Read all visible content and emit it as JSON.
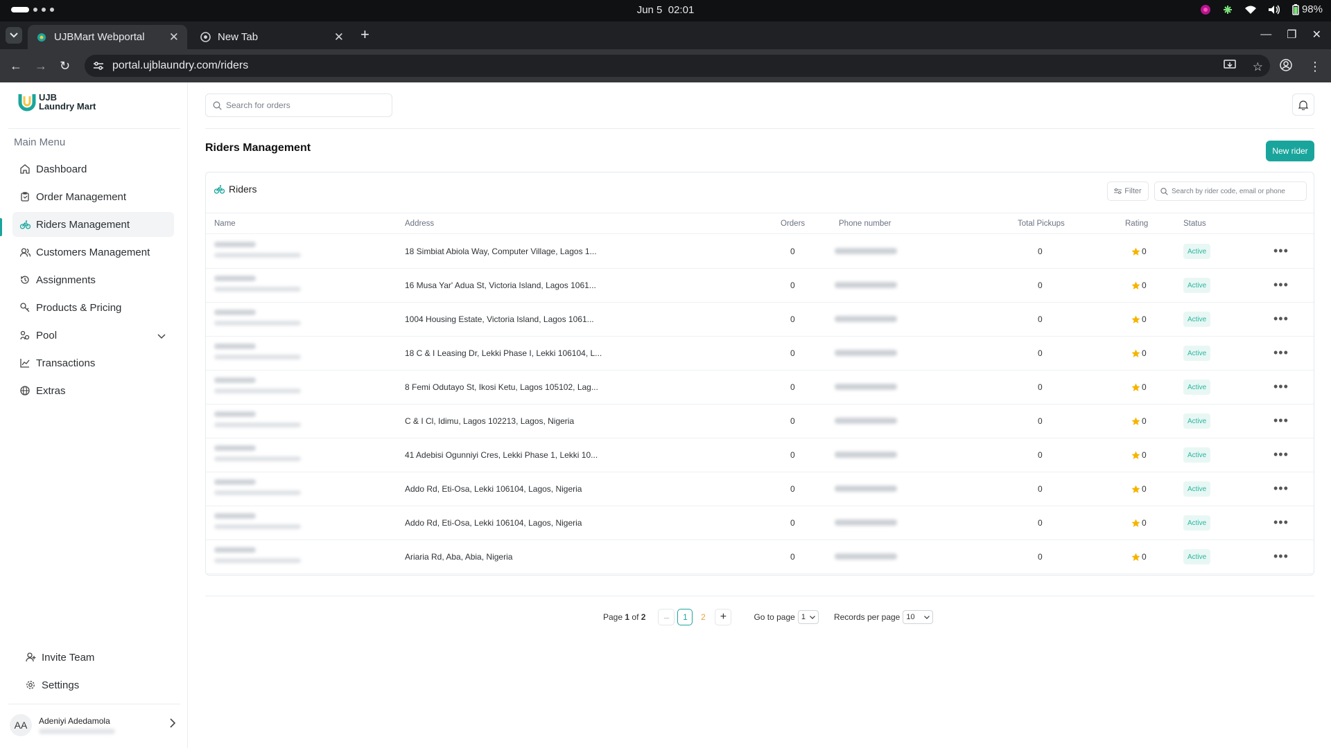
{
  "system": {
    "date": "Jun 5",
    "time": "02:01",
    "battery": "98%"
  },
  "browser": {
    "tabs": [
      {
        "title": "UJBMart Webportal"
      },
      {
        "title": "New Tab"
      }
    ],
    "url": "portal.ujblaundry.com/riders"
  },
  "sidebar": {
    "logo_line1": "UJB",
    "logo_line2": "Laundry Mart",
    "menu_title": "Main Menu",
    "items": [
      {
        "label": "Dashboard",
        "icon": "home-icon"
      },
      {
        "label": "Order Management",
        "icon": "clipboard-icon"
      },
      {
        "label": "Riders Management",
        "icon": "bike-icon"
      },
      {
        "label": "Customers Management",
        "icon": "users-icon"
      },
      {
        "label": "Assignments",
        "icon": "history-icon"
      },
      {
        "label": "Products & Pricing",
        "icon": "tag-icon"
      },
      {
        "label": "Pool",
        "icon": "pool-icon"
      },
      {
        "label": "Transactions",
        "icon": "chart-line-icon"
      },
      {
        "label": "Extras",
        "icon": "globe-icon"
      }
    ],
    "bottom_items": [
      {
        "label": "Invite Team",
        "icon": "user-plus-icon"
      },
      {
        "label": "Settings",
        "icon": "gear-icon"
      }
    ],
    "user": {
      "initials": "AA",
      "name": "Adeniyi Adedamola"
    }
  },
  "header": {
    "search_placeholder": "Search for orders"
  },
  "page": {
    "title": "Riders Management",
    "new_button": "New rider"
  },
  "card": {
    "title": "Riders",
    "filter_label": "Filter",
    "search_placeholder": "Search by rider code, email or phone",
    "columns": {
      "name": "Name",
      "address": "Address",
      "orders": "Orders",
      "phone": "Phone number",
      "pickups": "Total Pickups",
      "rating": "Rating",
      "status": "Status"
    },
    "rows": [
      {
        "address": "18 Simbiat Abiola Way, Computer Village, Lagos 1...",
        "orders": "0",
        "pickups": "0",
        "rating": "0",
        "status": "Active"
      },
      {
        "address": "16 Musa Yar' Adua St, Victoria Island, Lagos 1061...",
        "orders": "0",
        "pickups": "0",
        "rating": "0",
        "status": "Active"
      },
      {
        "address": "1004 Housing Estate, Victoria Island, Lagos 1061...",
        "orders": "0",
        "pickups": "0",
        "rating": "0",
        "status": "Active"
      },
      {
        "address": "18 C & I Leasing Dr, Lekki Phase I, Lekki 106104, L...",
        "orders": "0",
        "pickups": "0",
        "rating": "0",
        "status": "Active"
      },
      {
        "address": "8 Femi Odutayo St, Ikosi Ketu, Lagos 105102, Lag...",
        "orders": "0",
        "pickups": "0",
        "rating": "0",
        "status": "Active"
      },
      {
        "address": "C & I Cl, Idimu, Lagos 102213, Lagos, Nigeria",
        "orders": "0",
        "pickups": "0",
        "rating": "0",
        "status": "Active"
      },
      {
        "address": "41 Adebisi Ogunniyi Cres, Lekki Phase 1, Lekki 10...",
        "orders": "0",
        "pickups": "0",
        "rating": "0",
        "status": "Active"
      },
      {
        "address": "Addo Rd, Eti-Osa, Lekki 106104, Lagos, Nigeria",
        "orders": "0",
        "pickups": "0",
        "rating": "0",
        "status": "Active"
      },
      {
        "address": "Addo Rd, Eti-Osa, Lekki 106104, Lagos, Nigeria",
        "orders": "0",
        "pickups": "0",
        "rating": "0",
        "status": "Active"
      },
      {
        "address": "Ariaria Rd, Aba, Abia, Nigeria",
        "orders": "0",
        "pickups": "0",
        "rating": "0",
        "status": "Active"
      }
    ]
  },
  "pagination": {
    "page_label": "Page",
    "current": "1",
    "of_label": "of",
    "total": "2",
    "prev": "–",
    "next": "+",
    "goto_label": "Go to page",
    "goto_value": "1",
    "records_label": "Records per page",
    "records_value": "10"
  },
  "colors": {
    "accent": "#1aa59c",
    "active_badge_bg": "#e8f7f4",
    "star": "#f5b400"
  }
}
